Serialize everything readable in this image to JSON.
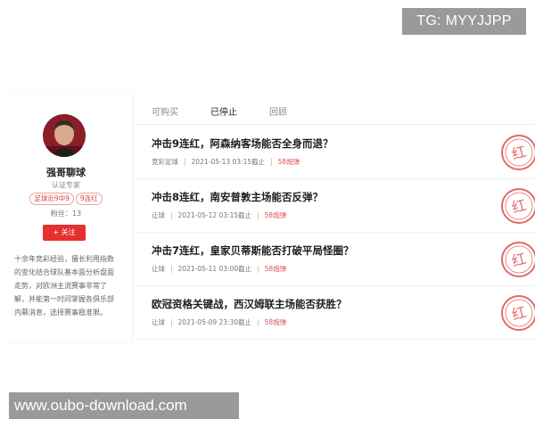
{
  "watermarks": {
    "top": "TG: MYYJJPP",
    "bottom": "www.oubo-download.com"
  },
  "profile": {
    "name": "强哥聊球",
    "certification": "认证专家",
    "tags": [
      "足球近9中9",
      "9连红"
    ],
    "fans": "粉丝：13",
    "follow_label": "+ 关注",
    "bio": "十余年竞彩经验，擅长利用指数的变化结合球队基本面分析盘面走势，对欧洲主流赛事非常了解，并能第一时间掌握各俱乐部内幕消息，选择赛事稳准狠。"
  },
  "tabs": [
    {
      "label": "可购买",
      "active": false
    },
    {
      "label": "已停止",
      "active": true
    },
    {
      "label": "回顾",
      "active": false
    }
  ],
  "articles": [
    {
      "title": "冲击9连红，阿森纳客场能否全身而退？",
      "category": "竞彩足球",
      "date": "2021-05-13 03:15截止",
      "price": "58炮弹",
      "stamp": "红"
    },
    {
      "title": "冲击8连红，南安普敦主场能否反弹？",
      "category": "让球",
      "date": "2021-05-12 03:15截止",
      "price": "58炮弹",
      "stamp": "红"
    },
    {
      "title": "冲击7连红，皇家贝蒂斯能否打破平局怪圈？",
      "category": "让球",
      "date": "2021-05-11 03:00截止",
      "price": "58炮弹",
      "stamp": "红"
    },
    {
      "title": "欧冠资格关键战，西汉姆联主场能否获胜？",
      "category": "让球",
      "date": "2021-05-09 23:30截止",
      "price": "58炮弹",
      "stamp": "红"
    }
  ],
  "colors": {
    "accent": "#e53030",
    "stamp": "#e06a6a",
    "watermark_bg": "#9a9a9a"
  }
}
